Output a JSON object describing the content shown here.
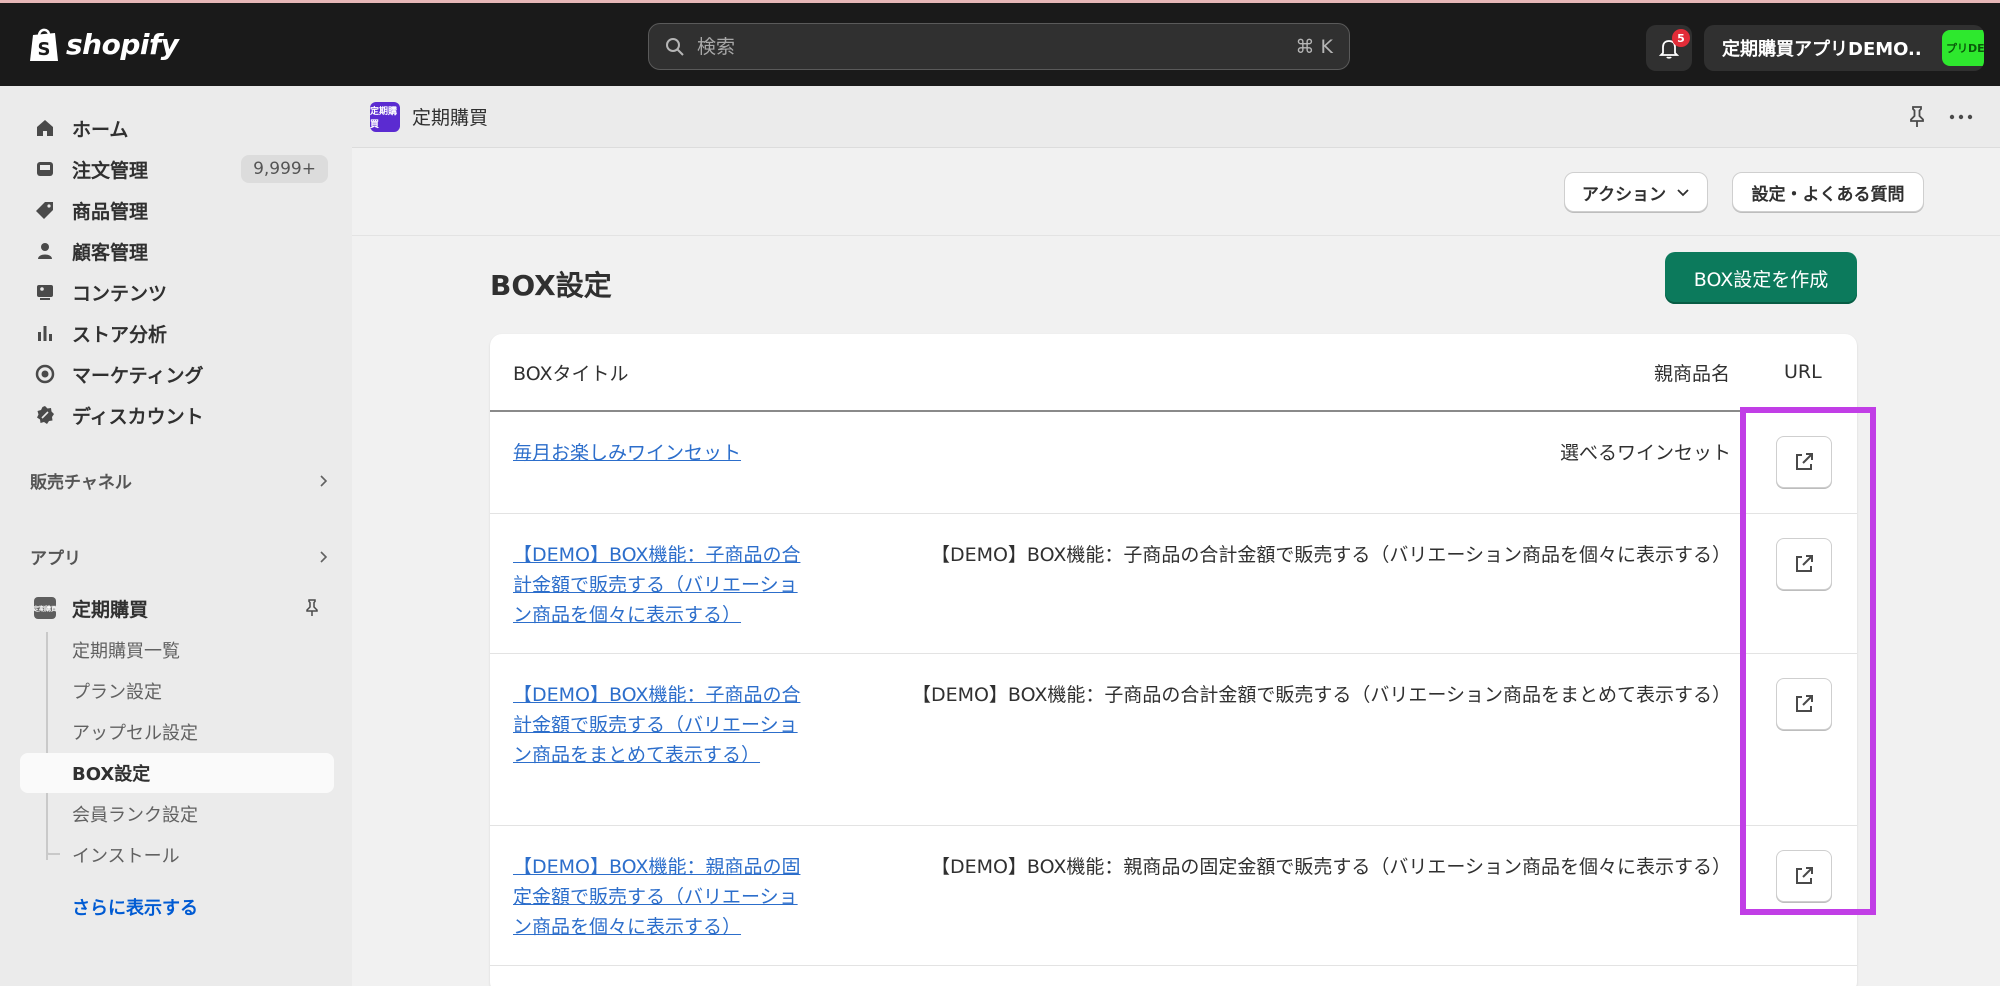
{
  "topbar": {
    "logo_text": "shopify",
    "search_placeholder": "検索",
    "search_shortcut": "⌘ K",
    "notification_count": "5",
    "store_name": "定期購買アプリDEMO...",
    "store_avatar_text": "プリDE"
  },
  "sidebar": {
    "nav": [
      {
        "label": "ホーム",
        "icon": "home-icon"
      },
      {
        "label": "注文管理",
        "icon": "inbox-icon",
        "badge": "9,999+"
      },
      {
        "label": "商品管理",
        "icon": "tag-icon"
      },
      {
        "label": "顧客管理",
        "icon": "person-icon"
      },
      {
        "label": "コンテンツ",
        "icon": "image-icon"
      },
      {
        "label": "ストア分析",
        "icon": "bar-chart-icon"
      },
      {
        "label": "マーケティング",
        "icon": "target-icon"
      },
      {
        "label": "ディスカウント",
        "icon": "discount-icon"
      }
    ],
    "sales_channels": "販売チャネル",
    "apps": "アプリ",
    "app_name": "定期購買",
    "app_sub": [
      "定期購買一覧",
      "プラン設定",
      "アップセル設定",
      "BOX設定",
      "会員ランク設定",
      "インストール"
    ],
    "show_more": "さらに表示する"
  },
  "app_header": {
    "icon_text": "定期購買",
    "title": "定期購買"
  },
  "actions": {
    "action_label": "アクション",
    "settings_label": "設定・よくある質問"
  },
  "page": {
    "title": "BOX設定",
    "create_label": "BOX設定を作成"
  },
  "table": {
    "headers": {
      "title": "BOXタイトル",
      "parent": "親商品名",
      "url": "URL"
    },
    "rows": [
      {
        "title": "毎月お楽しみワインセット",
        "parent": "選べるワインセット"
      },
      {
        "title": "【DEMO】BOX機能：子商品の合計金額で販売する（バリエーション商品を個々に表示する）",
        "parent": "【DEMO】BOX機能：子商品の合計金額で販売する（バリエーション商品を個々に表示する）"
      },
      {
        "title": "【DEMO】BOX機能：子商品の合計金額で販売する（バリエーション商品をまとめて表示する）",
        "parent": "【DEMO】BOX機能：子商品の合計金額で販売する（バリエーション商品をまとめて表示する）"
      },
      {
        "title": "【DEMO】BOX機能：親商品の固定金額で販売する（バリエーション商品を個々に表示する）",
        "parent": "【DEMO】BOX機能：親商品の固定金額で販売する（バリエーション商品を個々に表示する）"
      }
    ]
  },
  "colors": {
    "primary": "#0c7a5c",
    "link": "#2c6ecb",
    "highlight": "#c13ee6",
    "topbar": "#1a1a1a"
  }
}
